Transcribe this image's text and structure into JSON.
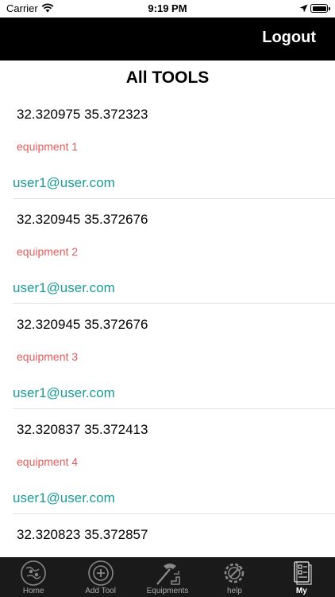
{
  "status_bar": {
    "carrier": "Carrier",
    "time": "9:19 PM"
  },
  "navbar": {
    "logout_label": "Logout"
  },
  "page": {
    "title": "All TOOLS"
  },
  "tools": [
    {
      "coords": "32.320975 35.372323",
      "equipment": "equipment 1",
      "user": "user1@user.com"
    },
    {
      "coords": "32.320945 35.372676",
      "equipment": "equipment 2",
      "user": "user1@user.com"
    },
    {
      "coords": "32.320945 35.372676",
      "equipment": "equipment 3",
      "user": "user1@user.com"
    },
    {
      "coords": "32.320837 35.372413",
      "equipment": "equipment 4",
      "user": "user1@user.com"
    },
    {
      "coords": "32.320823 35.372857",
      "equipment": "",
      "user": ""
    }
  ],
  "tabbar": {
    "tabs": [
      {
        "label": "Home",
        "icon": "home-map-icon"
      },
      {
        "label": "Add Tool",
        "icon": "add-tool-icon"
      },
      {
        "label": "Equipments",
        "icon": "equipments-icon"
      },
      {
        "label": "help",
        "icon": "help-gear-icon"
      },
      {
        "label": "My",
        "icon": "my-list-icon"
      }
    ],
    "active": "My"
  }
}
